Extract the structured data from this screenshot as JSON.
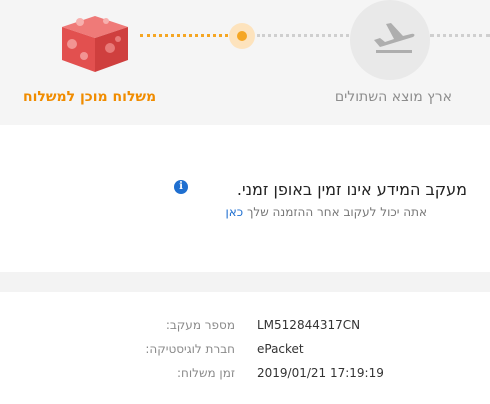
{
  "progress": {
    "steps": [
      {
        "label": "ארץ מוצא השתולים",
        "state": "done",
        "icon": "airplane-icon"
      },
      {
        "label": "משלוח מוכן למשלוח",
        "state": "current",
        "icon": "package-icon"
      }
    ],
    "active_color": "#f5a623",
    "current_label_color": "#f08c00"
  },
  "info": {
    "icon": "info-icon",
    "title": "מעקב המידע אינו זמין באופן זמני.",
    "subtitle": "אתה יכול לעקוב אחר ההזמנה שלך",
    "link_text": "כאן",
    "link_color": "#1f6fd0"
  },
  "details": {
    "rows": [
      {
        "label": "מספר מעקב:",
        "value": "LM512844317CN"
      },
      {
        "label": "חברת לוגיסטיקה:",
        "value": "ePacket"
      },
      {
        "label": "זמן משלוח:",
        "value": "2019/01/21 17:19:19"
      }
    ]
  }
}
